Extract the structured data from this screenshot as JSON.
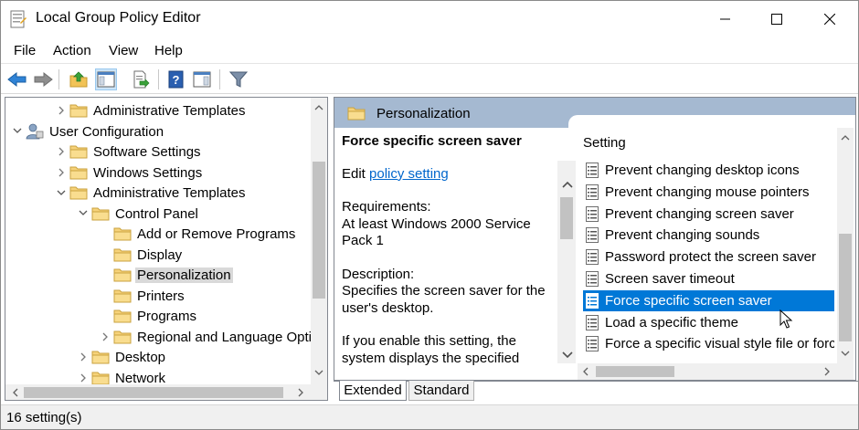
{
  "window": {
    "title": "Local Group Policy Editor",
    "controls": [
      "minimize",
      "maximize",
      "close"
    ]
  },
  "menu": [
    "File",
    "Action",
    "View",
    "Help"
  ],
  "toolbar": {
    "buttons": [
      "back-icon",
      "forward-icon",
      "up-folder-icon",
      "show-hide-console-tree-icon",
      "export-list-icon",
      "help-icon",
      "show-hide-action-pane-icon",
      "filter-icon"
    ]
  },
  "tree": {
    "items": [
      {
        "label": "Administrative Templates",
        "depth": 1,
        "expander": "collapsed",
        "icon": "folder-icon"
      },
      {
        "label": "User Configuration",
        "depth": 0,
        "expander": "expanded",
        "icon": "user-config-icon"
      },
      {
        "label": "Software Settings",
        "depth": 1,
        "expander": "collapsed",
        "icon": "folder-icon"
      },
      {
        "label": "Windows Settings",
        "depth": 1,
        "expander": "collapsed",
        "icon": "folder-icon"
      },
      {
        "label": "Administrative Templates",
        "depth": 1,
        "expander": "expanded",
        "icon": "folder-icon"
      },
      {
        "label": "Control Panel",
        "depth": 2,
        "expander": "expanded",
        "icon": "folder-icon"
      },
      {
        "label": "Add or Remove Programs",
        "depth": 3,
        "expander": "none",
        "icon": "folder-icon"
      },
      {
        "label": "Display",
        "depth": 3,
        "expander": "none",
        "icon": "folder-icon"
      },
      {
        "label": "Personalization",
        "depth": 3,
        "expander": "none",
        "icon": "folder-icon",
        "selected": true
      },
      {
        "label": "Printers",
        "depth": 3,
        "expander": "none",
        "icon": "folder-icon"
      },
      {
        "label": "Programs",
        "depth": 3,
        "expander": "none",
        "icon": "folder-icon"
      },
      {
        "label": "Regional and Language Options",
        "depth": 3,
        "expander": "collapsed",
        "icon": "folder-icon"
      },
      {
        "label": "Desktop",
        "depth": 2,
        "expander": "collapsed",
        "icon": "folder-icon"
      },
      {
        "label": "Network",
        "depth": 2,
        "expander": "collapsed",
        "icon": "folder-icon"
      }
    ]
  },
  "right_pane": {
    "header_title": "Personalization",
    "description": {
      "title": "Force specific screen saver",
      "edit_prefix": "Edit ",
      "edit_link": "policy setting ",
      "requirements_label": "Requirements:",
      "requirements_text": "At least Windows 2000 Service Pack 1",
      "description_label": "Description:",
      "description_text": "Specifies the screen saver for the user's desktop.",
      "more_text": "If you enable this setting, the system displays the specified"
    },
    "list": {
      "column_header": "Setting",
      "items": [
        {
          "label": "Prevent changing desktop icons"
        },
        {
          "label": "Prevent changing mouse pointers"
        },
        {
          "label": "Prevent changing screen saver"
        },
        {
          "label": "Prevent changing sounds"
        },
        {
          "label": "Password protect the screen saver"
        },
        {
          "label": "Screen saver timeout"
        },
        {
          "label": "Force specific screen saver",
          "selected": true
        },
        {
          "label": "Load a specific theme"
        },
        {
          "label": "Force a specific visual style file or force Windows Classic"
        }
      ]
    }
  },
  "tabs": [
    {
      "label": "Extended",
      "active": true
    },
    {
      "label": "Standard",
      "active": false
    }
  ],
  "status": {
    "text": "16 setting(s)"
  },
  "colors": {
    "selection": "#0078d7",
    "header_band": "#a5b9d1",
    "link": "#0066cc",
    "tree_selection": "#d9d9d9"
  }
}
